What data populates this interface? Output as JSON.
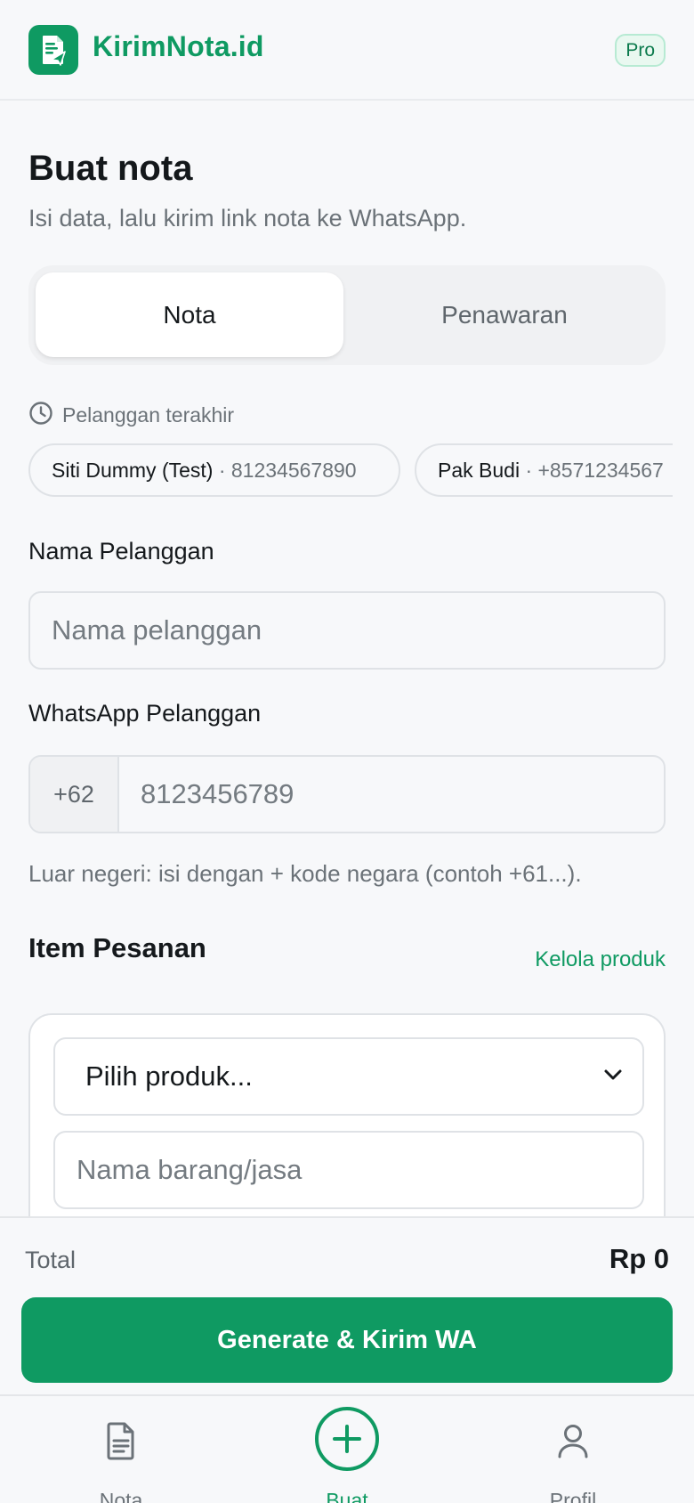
{
  "header": {
    "brand": "KirimNota.id",
    "logo_icon": "receipt-send-icon",
    "badge": "Pro",
    "accent_color": "#0f9a62"
  },
  "main": {
    "title": "Buat nota",
    "subtitle": "Isi data, lalu kirim link nota ke WhatsApp.",
    "tabs": [
      {
        "label": "Nota",
        "active": true
      },
      {
        "label": "Penawaran",
        "active": false
      }
    ],
    "recent": {
      "icon": "clock-icon",
      "label": "Pelanggan terakhir",
      "chips": [
        {
          "name": "Siti Dummy (Test)",
          "phone": "· 81234567890"
        },
        {
          "name": "Pak Budi",
          "phone": "· +8571234567"
        }
      ]
    },
    "customer_name": {
      "label": "Nama Pelanggan",
      "placeholder": "Nama pelanggan",
      "value": ""
    },
    "customer_whatsapp": {
      "label": "WhatsApp Pelanggan",
      "prefix": "+62",
      "placeholder": "8123456789",
      "value": "",
      "hint": "Luar negeri: isi dengan + kode negara (contoh +61...)."
    },
    "items": {
      "title": "Item Pesanan",
      "manage_link": "Kelola produk",
      "product_select": "Pilih produk...",
      "item_name_placeholder": "Nama barang/jasa"
    }
  },
  "summary": {
    "total_label": "Total",
    "total_value": "Rp 0",
    "cta_label": "Generate & Kirim WA"
  },
  "nav": {
    "items": [
      {
        "label": "Nota",
        "icon": "document-icon",
        "active": false
      },
      {
        "label": "Buat",
        "icon": "plus-circle-icon",
        "active": true
      },
      {
        "label": "Profil",
        "icon": "user-icon",
        "active": false
      }
    ]
  }
}
